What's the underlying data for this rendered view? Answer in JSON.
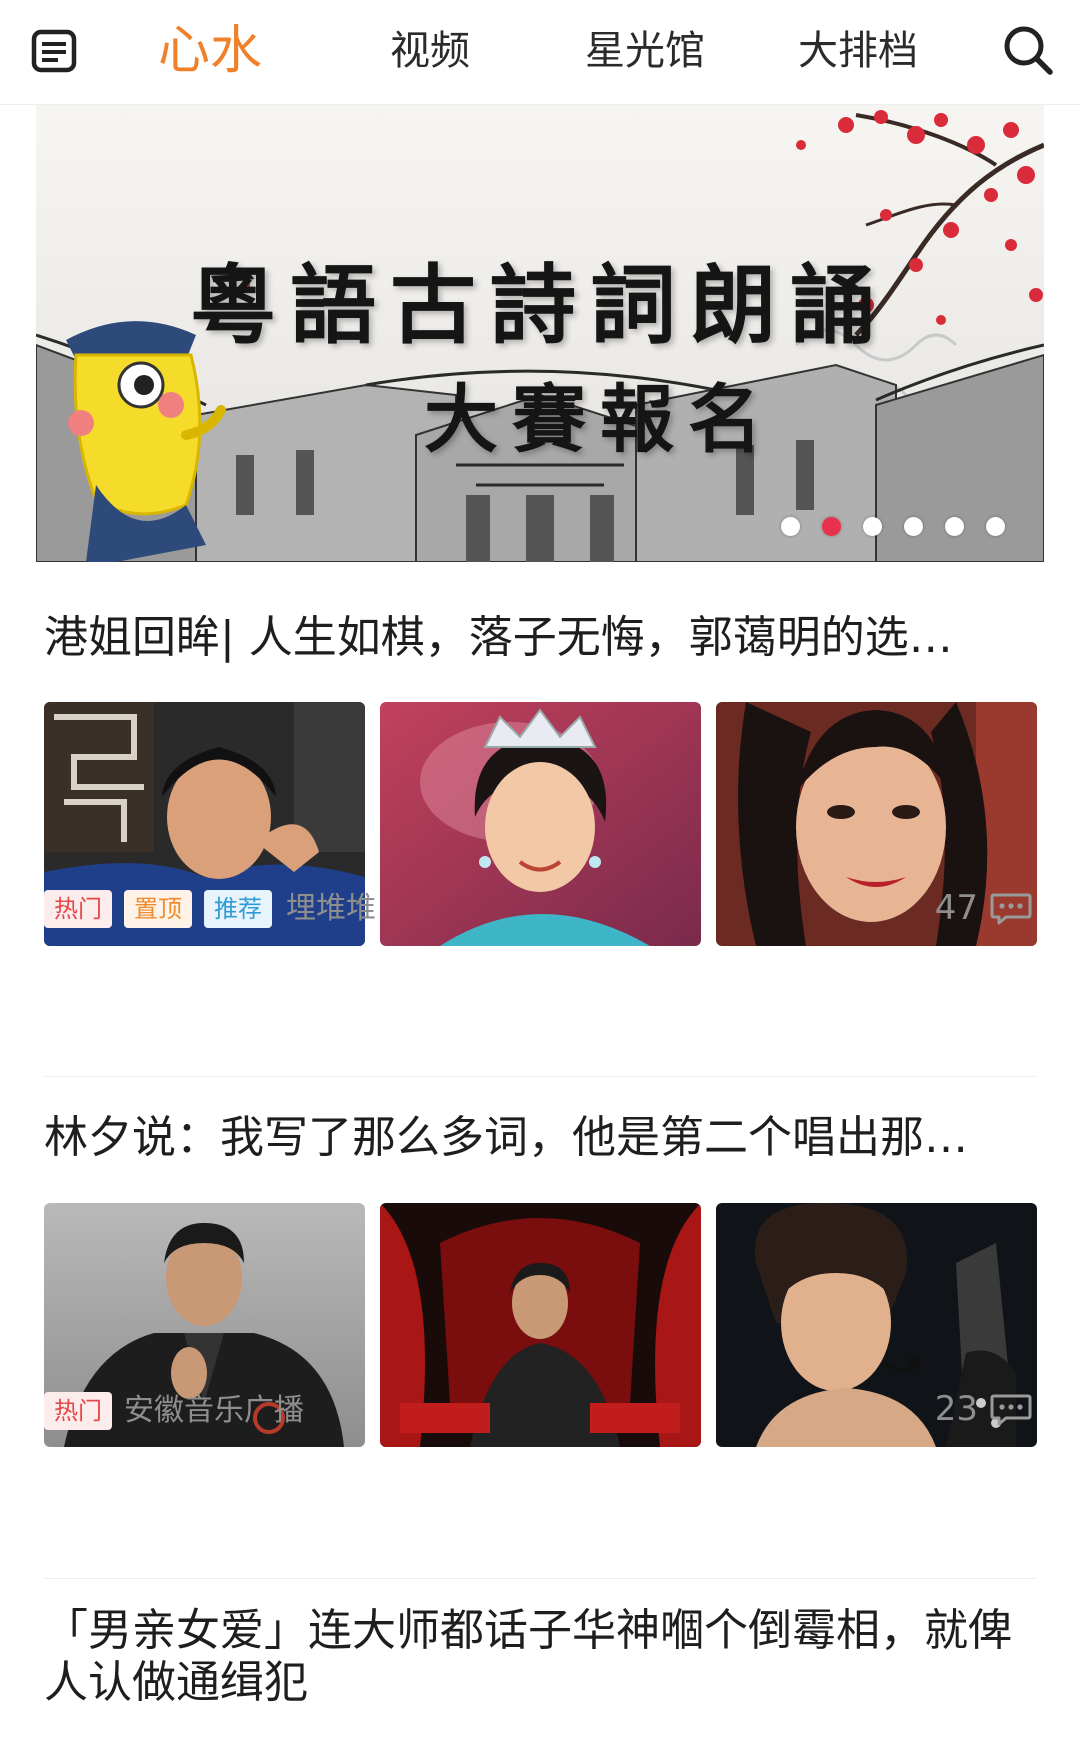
{
  "nav": {
    "tabs": [
      {
        "label": "心水",
        "active": true
      },
      {
        "label": "视频",
        "active": false
      },
      {
        "label": "星光馆",
        "active": false
      },
      {
        "label": "大排档",
        "active": false
      }
    ],
    "menu_icon": "news-list-icon",
    "search_icon": "search-icon",
    "accent_color": "#f0812a"
  },
  "banner": {
    "title_line1": "粵語古詩詞朗誦",
    "title_line2": "大賽報名",
    "slide_count": 6,
    "active_slide": 2
  },
  "articles": [
    {
      "title": "港姐回眸| 人生如棋，落子无悔，郭蔼明的选…",
      "tags": [
        {
          "label": "热门",
          "kind": "hot"
        },
        {
          "label": "置顶",
          "kind": "top"
        },
        {
          "label": "推荐",
          "kind": "rec"
        }
      ],
      "source": "埋堆堆",
      "comments": "47",
      "comment_icon": "comment-icon"
    },
    {
      "title": "林夕说：我写了那么多词，他是第二个唱出那…",
      "tags": [
        {
          "label": "热门",
          "kind": "hot"
        }
      ],
      "source": "安徽音乐广播",
      "comments": "23",
      "comment_icon": "comment-icon"
    },
    {
      "title": "「男亲女爱」连大师都话子华神嗰个倒霉相，就俾人认做通缉犯"
    }
  ],
  "colors": {
    "tag_hot": "#e54848",
    "tag_top": "#f08a2e",
    "tag_rec": "#2f9bd6",
    "dot_active": "#e8324d"
  }
}
